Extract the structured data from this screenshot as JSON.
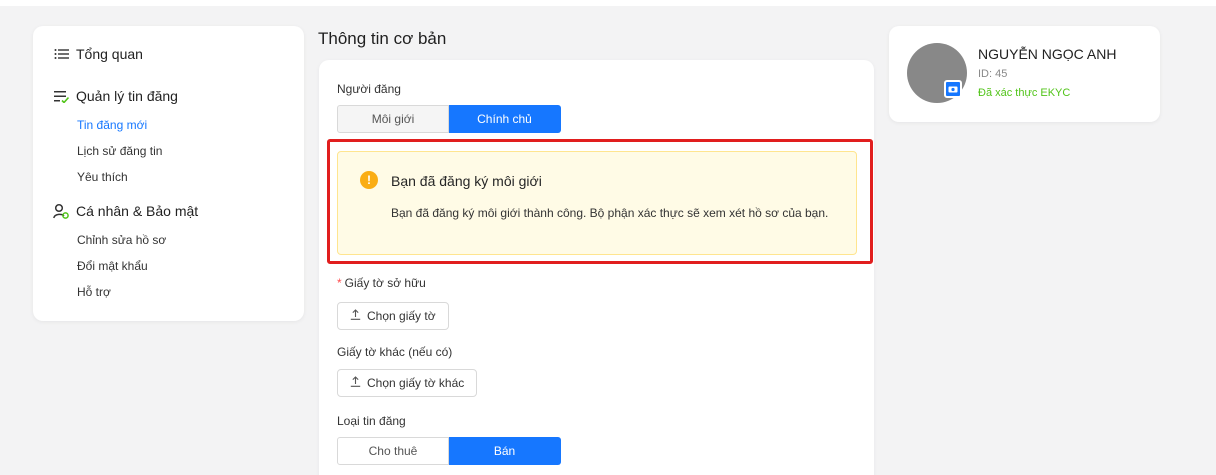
{
  "sidebar": {
    "overview": {
      "label": "Tổng quan",
      "icon": "list-icon"
    },
    "listings": {
      "label": "Quản lý tin đăng",
      "icon": "list-check-icon",
      "items": [
        {
          "label": "Tin đăng mới",
          "active": true
        },
        {
          "label": "Lịch sử đăng tin",
          "active": false
        },
        {
          "label": "Yêu thích",
          "active": false
        }
      ]
    },
    "account": {
      "label": "Cá nhân & Bảo mật",
      "icon": "user-settings-icon",
      "items": [
        {
          "label": "Chỉnh sửa hồ sơ"
        },
        {
          "label": "Đổi mật khẩu"
        },
        {
          "label": "Hỗ trợ"
        }
      ]
    }
  },
  "main": {
    "title": "Thông tin cơ bản",
    "poster": {
      "label": "Người đăng",
      "options": [
        "Môi giới",
        "Chính chủ"
      ],
      "selected": "Chính chủ"
    },
    "alert": {
      "icon": "warning-icon",
      "icon_text": "!",
      "title": "Bạn đã đăng ký môi giới",
      "description": "Bạn đã đăng ký môi giới thành công. Bộ phận xác thực sẽ xem xét hồ sơ của bạn."
    },
    "ownership_docs": {
      "required_mark": "*",
      "label": "Giấy tờ sở hữu",
      "button": "Chọn giấy tờ"
    },
    "other_docs": {
      "label": "Giấy tờ khác (nếu có)",
      "button": "Chọn giấy tờ khác"
    },
    "listing_type": {
      "label": "Loại tin đăng",
      "options": [
        "Cho thuê",
        "Bán"
      ],
      "selected": "Bán"
    }
  },
  "profile": {
    "name": "NGUYỄN NGỌC ANH",
    "id": "ID: 45",
    "verification": "Đã xác thực EKYC"
  },
  "colors": {
    "accent": "#1677ff",
    "highlight_border": "#e11e1e",
    "alert_bg": "#fffbe6",
    "verified": "#52c41a"
  }
}
